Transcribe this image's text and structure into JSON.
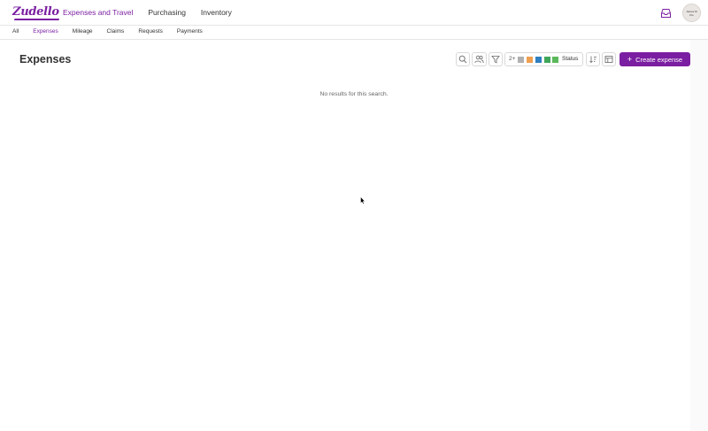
{
  "app": {
    "logo_text": "Zudello",
    "brand_color": "#7b1fa2"
  },
  "top_nav": {
    "items": [
      {
        "label": "Expenses and Travel",
        "active": true
      },
      {
        "label": "Purchasing",
        "active": false
      },
      {
        "label": "Inventory",
        "active": false
      }
    ]
  },
  "user": {
    "avatar_line1": "James M",
    "avatar_line2": "Flo"
  },
  "sub_nav": {
    "tabs": [
      {
        "label": "All",
        "active": false
      },
      {
        "label": "Expenses",
        "active": true
      },
      {
        "label": "Mileage",
        "active": false
      },
      {
        "label": "Claims",
        "active": false
      },
      {
        "label": "Requests",
        "active": false
      },
      {
        "label": "Payments",
        "active": false
      }
    ]
  },
  "main": {
    "title": "Expenses",
    "empty_message": "No results for this search."
  },
  "toolbar": {
    "status_filter": {
      "count": "2+",
      "label": "Status",
      "swatches": [
        "#b0b0b0",
        "#f0a050",
        "#2f7fc1",
        "#3fa65a",
        "#5cb85c"
      ]
    },
    "create_label": "Create expense"
  },
  "icons": {
    "search": "search-icon",
    "people": "people-icon",
    "filter": "filter-icon",
    "sort": "sort-icon",
    "columns": "columns-icon",
    "inbox": "inbox-icon"
  }
}
